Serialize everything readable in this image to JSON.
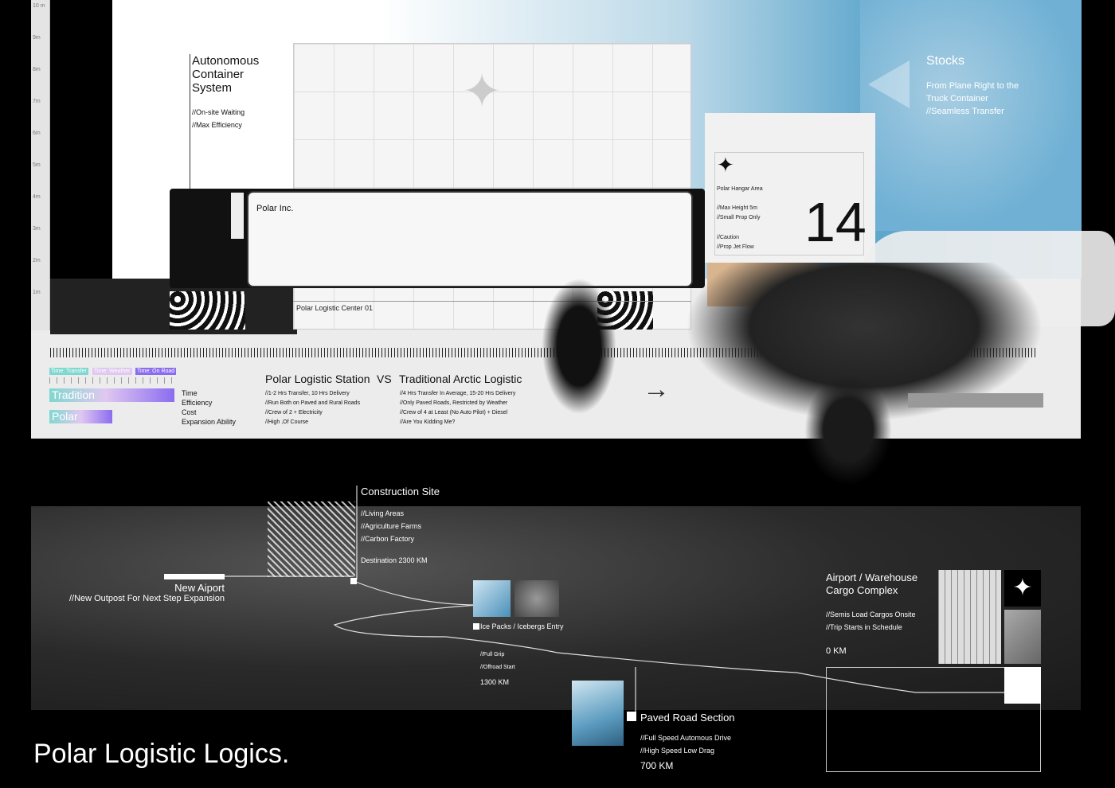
{
  "ruler": {
    "labels": [
      "10 m",
      "9m",
      "8m",
      "7m",
      "6m",
      "5m",
      "4m",
      "3m",
      "2m",
      "1m"
    ]
  },
  "container": {
    "title": [
      "Autonomous",
      "Container",
      "System"
    ],
    "notes": [
      "//On-site Waiting",
      "//Max Efficiency"
    ]
  },
  "truck": {
    "brand": "Polar Inc.",
    "station": "Polar Logistic Center 01"
  },
  "stocks": {
    "title": "Stocks",
    "lines": [
      "From Plane Right to the",
      "Truck Container",
      "//Seamless Transfer"
    ]
  },
  "hangar": {
    "title": "Polar Hangar Area",
    "notes": [
      "//Max Height 5m",
      "//Small Prop Only",
      "//Caution",
      "//Prop Jet Flow"
    ],
    "number": "14"
  },
  "legend": {
    "tags": [
      "Time: Transfer",
      "Time: Weather",
      "Time: On Road"
    ],
    "bars": [
      "Tradition",
      "Polar"
    ],
    "criteria": [
      "Time",
      "Efficiency",
      "Cost",
      "Expansion Ability"
    ]
  },
  "comparison": {
    "left_title": "Polar Logistic Station",
    "vs": "VS",
    "right_title": "Traditional Arctic Logistic",
    "left": [
      "//1-2 Hrs Transfer, 10 Hrs Delivery",
      "//Run Both on Paved and Rural Roads",
      "//Crew of 2 + Electricity",
      "//High ,Of Course"
    ],
    "right": [
      "//4 Hrs Transfer In Average, 15-20 Hrs Delivery",
      "//Only Paved Roads, Restricted by Weather",
      "//Crew of 4 at Least (No Auto Pilot) + Diesel",
      "//Are You Kidding Me?"
    ]
  },
  "map": {
    "construction": {
      "title": "Construction Site",
      "notes": [
        "//Living Areas",
        "//Agriculture Farms",
        "//Carbon Factory"
      ],
      "distance": "Destination 2300 KM"
    },
    "airport_new": {
      "title": "New Aiport",
      "note": "//New Outpost For Next Step Expansion"
    },
    "ice": {
      "title": "Ice Packs / Icebergs Entry",
      "notes": [
        "//Full Grip",
        "//Offroad Start"
      ],
      "distance": "1300 KM"
    },
    "road": {
      "title": "Paved Road Section",
      "notes": [
        "//Full Speed Automous Drive",
        "//High Speed Low Drag"
      ],
      "distance": "700 KM"
    },
    "cargo": {
      "title": [
        "Airport / Warehouse",
        "Cargo Complex"
      ],
      "notes": [
        "//Semis Load Cargos Onsite",
        "//Trip Starts in Schedule"
      ],
      "distance": "0 KM"
    }
  },
  "page_title": "Polar Logistic Logics.",
  "colors": {
    "teal": "#7fd8cf",
    "lilac": "#e0c8f0",
    "violet": "#8b6cf0",
    "sky": "#5ea6cc"
  }
}
